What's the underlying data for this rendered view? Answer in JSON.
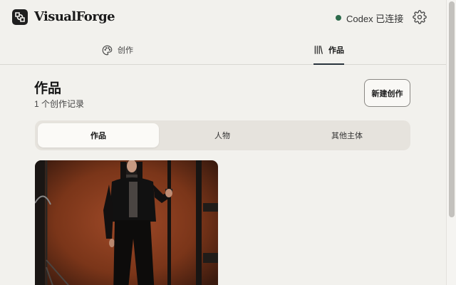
{
  "app": {
    "brand": "VisualForge",
    "status_text": "Codex 已连接",
    "status_color": "#2e6b4c",
    "logo_icon": "visualforge-logo-icon",
    "settings_icon": "gear-icon"
  },
  "nav": {
    "tabs": [
      {
        "label": "创作",
        "icon": "palette-icon",
        "active": false
      },
      {
        "label": "作品",
        "icon": "library-icon",
        "active": true
      }
    ]
  },
  "main": {
    "title": "作品",
    "record_count": "1 个创作记录",
    "new_button": "新建创作",
    "filters": [
      {
        "label": "作品",
        "selected": true
      },
      {
        "label": "人物",
        "selected": false
      },
      {
        "label": "其他主体",
        "selected": false
      }
    ],
    "gallery": [
      {
        "kind": "photo",
        "description_icon": "portrait-photo"
      }
    ]
  },
  "colors": {
    "background": "#f2f1ed",
    "accent_underline": "#29333c",
    "card_backdrop": "#8a3e22"
  }
}
